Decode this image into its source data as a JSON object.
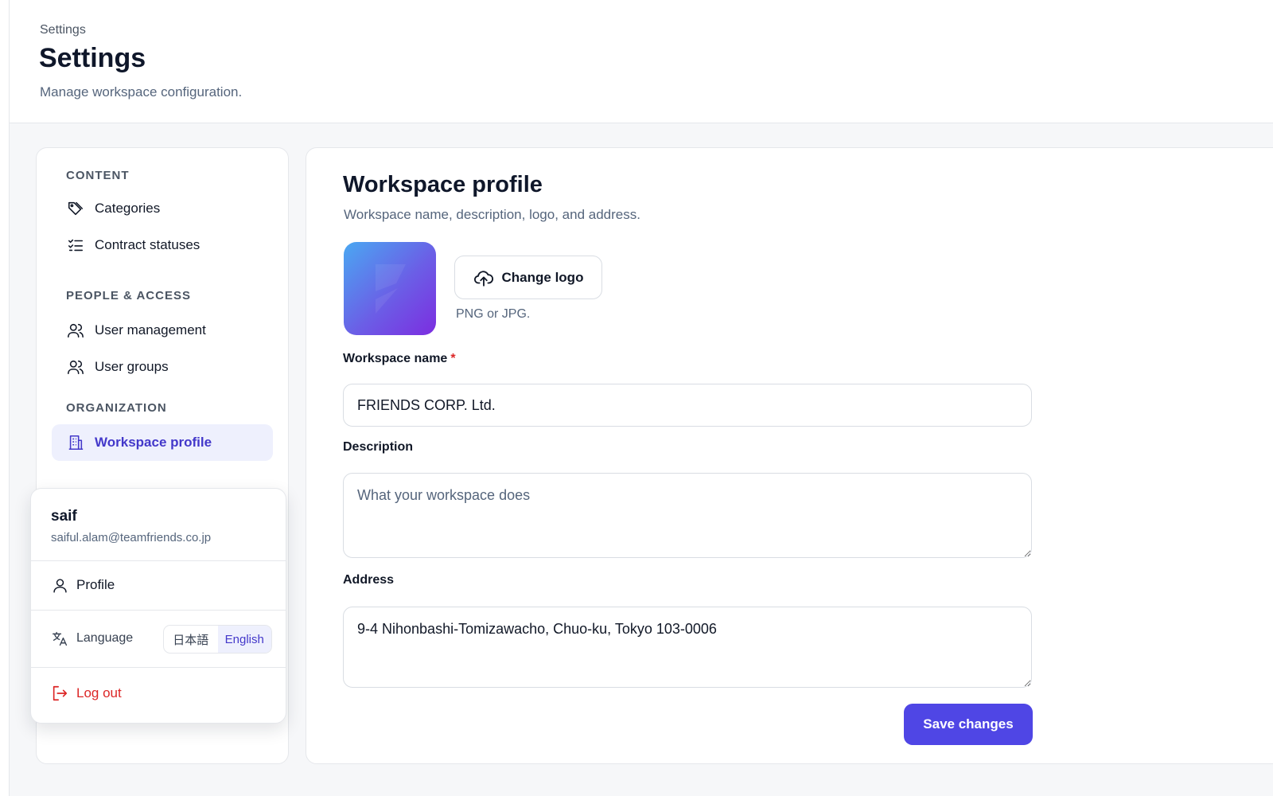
{
  "header": {
    "breadcrumb": "Settings",
    "title": "Settings",
    "subtitle": "Manage workspace configuration."
  },
  "sidebar": {
    "sections": [
      {
        "label": "CONTENT",
        "items": [
          {
            "label": "Categories",
            "icon": "tag-icon"
          },
          {
            "label": "Contract statuses",
            "icon": "checklist-icon"
          }
        ]
      },
      {
        "label": "PEOPLE & ACCESS",
        "items": [
          {
            "label": "User management",
            "icon": "users-icon"
          },
          {
            "label": "User groups",
            "icon": "users-icon"
          }
        ]
      },
      {
        "label": "ORGANIZATION",
        "items": [
          {
            "label": "Workspace profile",
            "icon": "building-icon",
            "active": true
          }
        ]
      }
    ]
  },
  "user_menu": {
    "name": "saif",
    "email": "saiful.alam@teamfriends.co.jp",
    "profile_label": "Profile",
    "language_label": "Language",
    "language_options": [
      "日本語",
      "English"
    ],
    "language_selected": "English",
    "logout_label": "Log out"
  },
  "workspace_profile": {
    "title": "Workspace profile",
    "subtitle": "Workspace name, description, logo, and address.",
    "change_logo_label": "Change logo",
    "logo_hint": "PNG or JPG.",
    "name_label": "Workspace name",
    "required_marker": "*",
    "name_value": "FRIENDS CORP. Ltd.",
    "description_label": "Description",
    "description_placeholder": "What your workspace does",
    "description_value": "",
    "address_label": "Address",
    "address_value": "9-4 Nihonbashi-Tomizawacho, Chuo-ku, Tokyo 103-0006",
    "save_label": "Save changes"
  },
  "colors": {
    "accent": "#4f46e5",
    "accent_soft": "#eef0fd",
    "danger": "#dc2626",
    "logo_gradient": [
      "#4aa8f2",
      "#6b5ee6",
      "#7c2de0"
    ]
  }
}
